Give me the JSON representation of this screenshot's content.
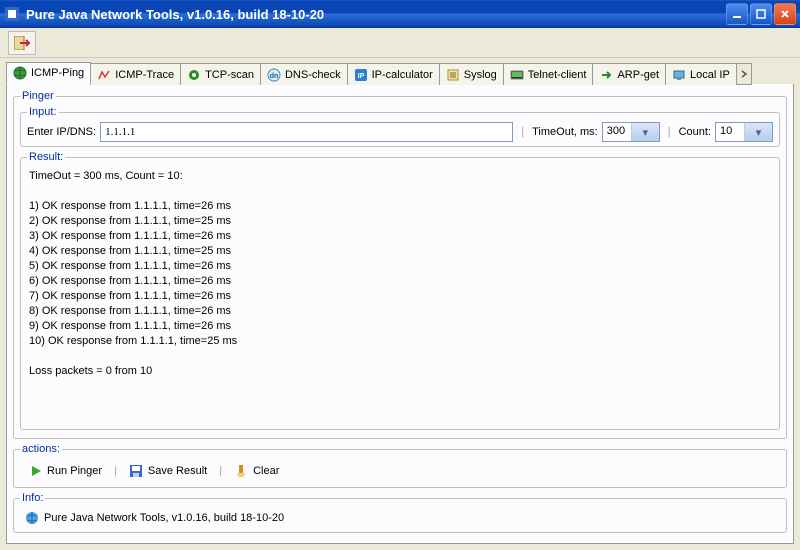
{
  "window": {
    "title": "Pure Java Network Tools,  v1.0.16, build 18-10-20"
  },
  "tabs": [
    "ICMP-Ping",
    "ICMP-Trace",
    "TCP-scan",
    "DNS-check",
    "IP-calculator",
    "Syslog",
    "Telnet-client",
    "ARP-get",
    "Local IP"
  ],
  "pinger": {
    "legend": "Pinger",
    "input": {
      "legend": "Input:",
      "label": "Enter IP/DNS:",
      "value": "1.1.1.1",
      "timeout_label": "TimeOut, ms:",
      "timeout_value": "300",
      "count_label": "Count:",
      "count_value": "10"
    },
    "result": {
      "legend": "Result:",
      "header": "TimeOut = 300 ms, Count = 10:",
      "lines": [
        "1) OK response from 1.1.1.1, time=26 ms",
        "2) OK response from 1.1.1.1, time=25 ms",
        "3) OK response from 1.1.1.1, time=26 ms",
        "4) OK response from 1.1.1.1, time=25 ms",
        "5) OK response from 1.1.1.1, time=26 ms",
        "6) OK response from 1.1.1.1, time=26 ms",
        "7) OK response from 1.1.1.1, time=26 ms",
        "8) OK response from 1.1.1.1, time=26 ms",
        "9) OK response from 1.1.1.1, time=26 ms",
        "10) OK response from 1.1.1.1, time=25 ms"
      ],
      "footer": "Loss packets = 0 from 10"
    }
  },
  "actions": {
    "legend": "actions:",
    "run": "Run Pinger",
    "save": "Save Result",
    "clear": "Clear"
  },
  "info": {
    "legend": "Info:",
    "text": "Pure Java Network Tools,  v1.0.16, build 18-10-20"
  }
}
